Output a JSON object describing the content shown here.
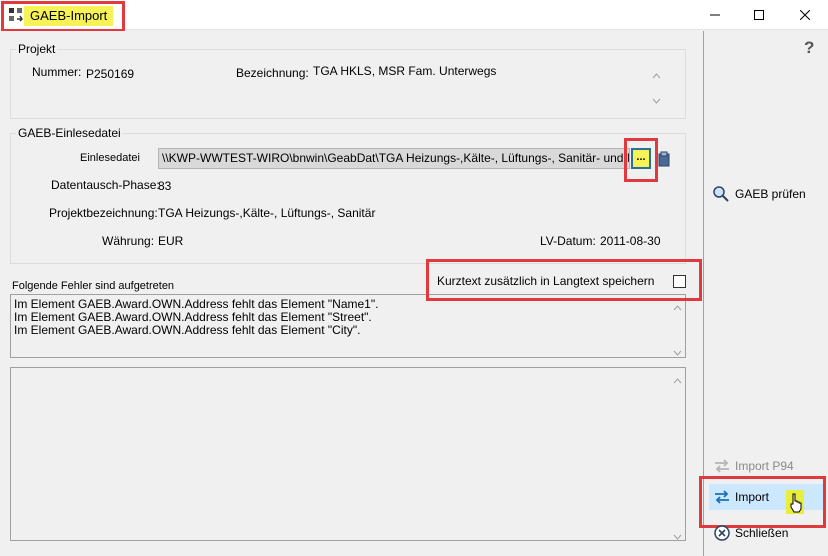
{
  "window": {
    "title": "GAEB-Import",
    "controls": {
      "minimize_icon": "minimize-icon",
      "maximize_icon": "maximize-icon",
      "close_icon": "close-icon"
    }
  },
  "projekt": {
    "group_label": "Projekt",
    "nummer_label": "Nummer:",
    "nummer_value": "P250169",
    "bezeichnung_label": "Bezeichnung:",
    "bezeichnung_value": "TGA HKLS, MSR Fam. Unterwegs"
  },
  "einlesedatei": {
    "group_label": "GAEB-Einlesedatei",
    "datei_label": "Einlesedatei",
    "datei_path": "\\\\KWP-WWTEST-WIRO\\bnwin\\GeabDat\\TGA Heizungs-,Kälte-, Lüftungs-, Sanitär- und MSR-Anl",
    "browse_label": "...",
    "phase_label": "Datentausch-Phase:",
    "phase_value": "83",
    "projektbez_label": "Projektbezeichnung:",
    "projektbez_value": "TGA Heizungs-,Kälte-, Lüftungs-, Sanitär",
    "waehrung_label": "Währung:",
    "waehrung_value": "EUR",
    "lvdatum_label": "LV-Datum:",
    "lvdatum_value": "2011-08-30"
  },
  "fehler": {
    "label": "Folgende Fehler sind aufgetreten",
    "lines": [
      "Im Element GAEB.Award.OWN.Address fehlt das Element \"Name1\".",
      "Im Element GAEB.Award.OWN.Address fehlt das Element \"Street\".",
      "Im Element GAEB.Award.OWN.Address fehlt das Element \"City\"."
    ]
  },
  "kurztext": {
    "label": "Kurztext zusätzlich in Langtext speichern",
    "checked": false
  },
  "rightpanel": {
    "help_label": "?",
    "gaeb_pruefen_label": "GAEB prüfen",
    "import_p94_label": "Import P94",
    "import_label": "Import",
    "schliessen_label": "Schließen"
  },
  "colors": {
    "highlight_yellow": "#f7f255",
    "annotation_red": "#e0393e",
    "active_button": "#cce8ff"
  }
}
